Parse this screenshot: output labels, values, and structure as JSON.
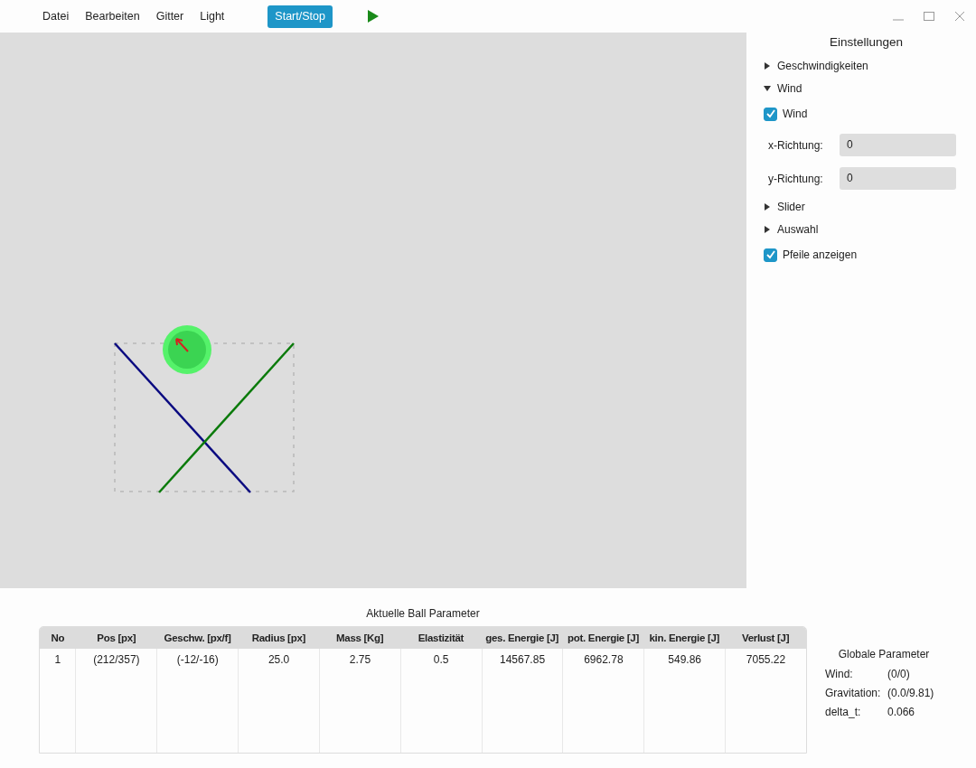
{
  "menu": [
    "Datei",
    "Bearbeiten",
    "Gitter",
    "Light"
  ],
  "toolbar": {
    "start_button": "Start/Stop"
  },
  "settings": {
    "title": "Einstellungen",
    "items": [
      {
        "kind": "section",
        "label": "Geschwindigkeiten",
        "expanded": false
      },
      {
        "kind": "section",
        "label": "Wind",
        "expanded": true,
        "children": [
          {
            "kind": "checkbox",
            "label": "Wind",
            "checked": true
          },
          {
            "kind": "field",
            "label": "x-Richtung:",
            "value": "0"
          },
          {
            "kind": "field",
            "label": "y-Richtung:",
            "value": "0"
          }
        ]
      },
      {
        "kind": "section",
        "label": "Slider",
        "expanded": false
      },
      {
        "kind": "section",
        "label": "Auswahl",
        "expanded": false
      },
      {
        "kind": "checkbox",
        "label": "Pfeile anzeigen",
        "checked": true
      }
    ]
  },
  "ball_table": {
    "title": "Aktuelle Ball Parameter",
    "columns": [
      "No",
      "Pos [px]",
      "Geschw. [px/f]",
      "Radius [px]",
      "Mass [Kg]",
      "Elastizität",
      "ges. Energie [J]",
      "pot. Energie [J]",
      "kin. Energie [J]",
      "Verlust [J]"
    ],
    "rows": [
      [
        "1",
        "(212/357)",
        "(-12/-16)",
        "25.0",
        "2.75",
        "0.5",
        "14567.85",
        "6962.78",
        "549.86",
        "7055.22"
      ]
    ]
  },
  "global_params": {
    "title": "Globale Parameter",
    "rows": [
      {
        "label": "Wind:",
        "value": "(0/0)"
      },
      {
        "label": "Gravitation:",
        "value": "(0.0/9.81)"
      },
      {
        "label": "delta_t:",
        "value": "0.066"
      }
    ]
  }
}
